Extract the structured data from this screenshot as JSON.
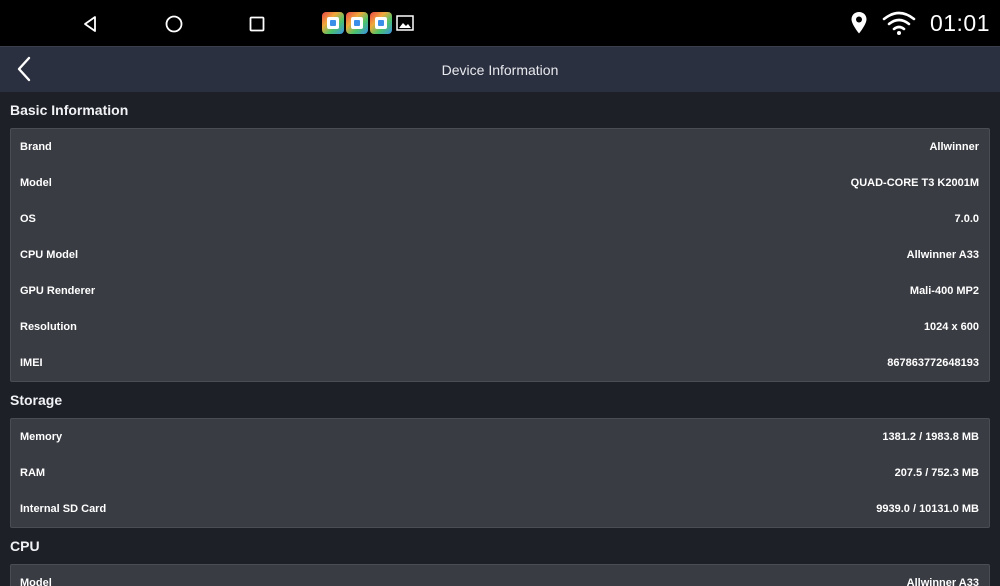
{
  "status_bar": {
    "clock": "01:01",
    "nav": [
      "back-icon",
      "home-icon",
      "recents-icon"
    ],
    "icons": [
      "location-icon",
      "wifi-icon"
    ]
  },
  "title_bar": {
    "title": "Device Information"
  },
  "sections": {
    "basic": {
      "title": "Basic Information",
      "rows": [
        {
          "label": "Brand",
          "value": "Allwinner"
        },
        {
          "label": "Model",
          "value": "QUAD-CORE T3 K2001M"
        },
        {
          "label": "OS",
          "value": "7.0.0"
        },
        {
          "label": "CPU Model",
          "value": "Allwinner A33"
        },
        {
          "label": "GPU Renderer",
          "value": "Mali-400 MP2"
        },
        {
          "label": "Resolution",
          "value": "1024 x 600"
        },
        {
          "label": "IMEI",
          "value": "867863772648193"
        }
      ]
    },
    "storage": {
      "title": "Storage",
      "rows": [
        {
          "label": "Memory",
          "value": "1381.2 / 1983.8 MB"
        },
        {
          "label": "RAM",
          "value": "207.5 / 752.3 MB"
        },
        {
          "label": "Internal SD Card",
          "value": "9939.0 / 10131.0 MB"
        }
      ]
    },
    "cpu": {
      "title": "CPU",
      "rows": [
        {
          "label": "Model",
          "value": "Allwinner A33"
        }
      ]
    }
  }
}
